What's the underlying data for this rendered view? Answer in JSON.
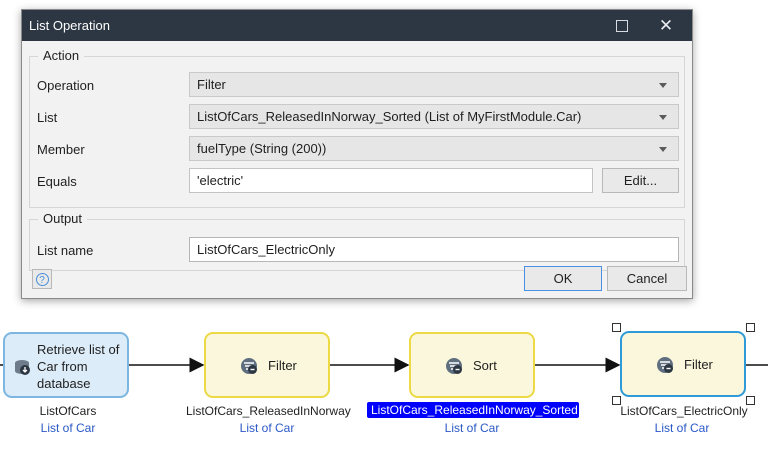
{
  "dialog": {
    "title": "List Operation",
    "action_group": {
      "legend": "Action",
      "operation": {
        "label": "Operation",
        "value": "Filter"
      },
      "list": {
        "label": "List",
        "value": "ListOfCars_ReleasedInNorway_Sorted (List of MyFirstModule.Car)"
      },
      "member": {
        "label": "Member",
        "value": "fuelType (String (200))"
      },
      "equals": {
        "label": "Equals",
        "value": "'electric'",
        "edit_label": "Edit..."
      }
    },
    "output_group": {
      "legend": "Output",
      "list_name": {
        "label": "List name",
        "value": "ListOfCars_ElectricOnly"
      }
    },
    "ok_label": "OK",
    "cancel_label": "Cancel"
  },
  "flow": {
    "activities": [
      {
        "label": "Retrieve list of Car from database",
        "var": "ListOfCars",
        "type": "List of Car",
        "icon": "retrieve-database-icon"
      },
      {
        "label": "Filter",
        "var": "ListOfCars_ReleasedInNorway",
        "type": "List of Car",
        "icon": "list-filter-icon"
      },
      {
        "label": "Sort",
        "var": "ListOfCars_ReleasedInNorway_Sorted",
        "type": "List of Car",
        "icon": "list-sort-icon"
      },
      {
        "label": "Filter",
        "var": "ListOfCars_ElectricOnly",
        "type": "List of Car",
        "icon": "list-filter-icon"
      }
    ]
  },
  "colors": {
    "titlebar": "#2d3643",
    "retrieve_fill": "#dcecf8",
    "list_op_fill": "#fbf7dc",
    "list_op_border": "#ecd943",
    "selected_border": "#2f9ad8",
    "type_text": "#2a59c7",
    "selection_highlight": "#0000ff"
  }
}
